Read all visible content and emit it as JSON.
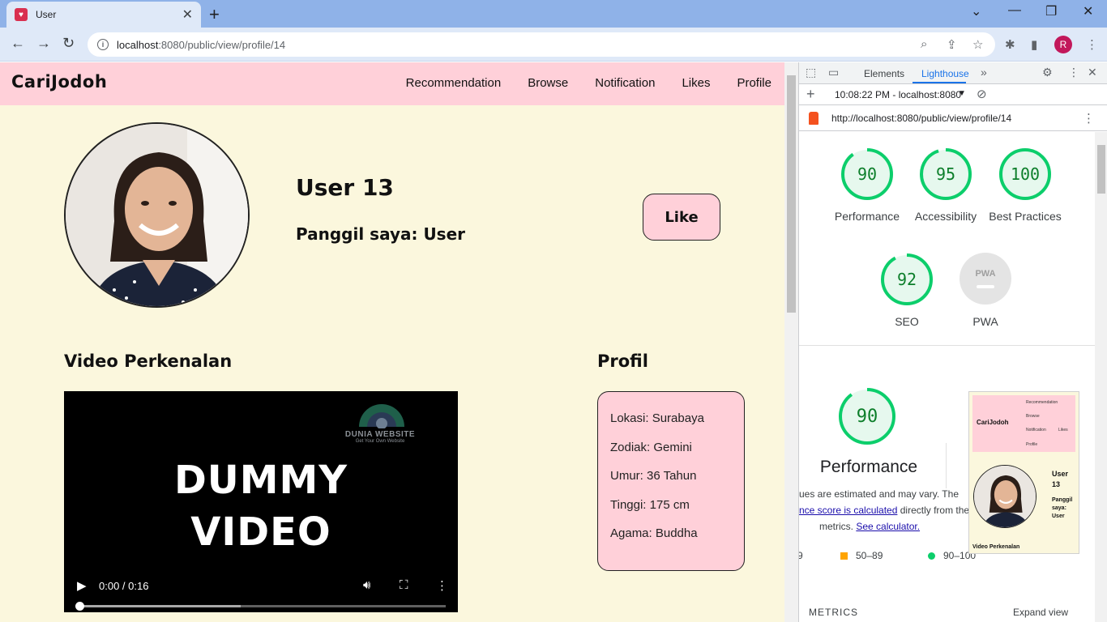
{
  "browser": {
    "tab_title": "User",
    "url_host": "localhost",
    "url_port_path": ":8080/public/view/profile/14",
    "profile_initial": "R"
  },
  "site": {
    "logo": "CariJodoh",
    "nav": [
      "Recommendation",
      "Browse",
      "Notification",
      "Likes",
      "Profile"
    ]
  },
  "profile": {
    "name": "User 13",
    "nickname": "Panggil saya: User",
    "like_label": "Like",
    "video_heading": "Video Perkenalan",
    "profil_heading": "Profil",
    "details": [
      "Lokasi: Surabaya",
      "Zodiak: Gemini",
      "Umur: 36 Tahun",
      "Tinggi: 175 cm",
      "Agama: Buddha"
    ]
  },
  "video": {
    "watermark": "DUNIA WEBSITE",
    "watermark_sub": "Get Your Own Website",
    "title_line1": "DUMMY",
    "title_line2": "VIDEO",
    "time": "0:00 / 0:16",
    "progress_buffered": 0.44
  },
  "devtools": {
    "tabs": [
      "Elements",
      "Lighthouse"
    ],
    "active_tab": "Lighthouse",
    "report_time": "10:08:22 PM - localhost:8080",
    "report_url": "http://localhost:8080/public/view/profile/14",
    "scores": [
      {
        "label": "Performance",
        "value": 90
      },
      {
        "label": "Accessibility",
        "value": 95
      },
      {
        "label": "Best Practices",
        "value": 100
      },
      {
        "label": "SEO",
        "value": 92
      }
    ],
    "pwa_label": "PWA",
    "pwa_badge": "PWA",
    "perf_score": 90,
    "perf_title": "Performance",
    "perf_note_1": "ues are estimated and may vary. The",
    "perf_note_link1": "nce score is calculated",
    "perf_note_2": "directly from thes",
    "perf_note_3": "metrics.",
    "perf_note_link2": "See calculator.",
    "legend_partial": "9",
    "legend_mid": "50–89",
    "legend_high": "90–100",
    "metrics_label": "METRICS",
    "expand_label": "Expand view",
    "thumb_logo": "CariJodoh",
    "thumb_menu": [
      "Recommendation",
      "Browse",
      "Notification",
      "Likes",
      "Profile"
    ],
    "thumb_user": "User 13",
    "thumb_nick": "Panggil saya: User",
    "thumb_video": "Video Perkenalan"
  },
  "colors": {
    "page_bg": "#fbf7dd",
    "nav_pink": "#ffd0d9",
    "score_green": "#0cce6b",
    "score_orange": "#ffa400"
  }
}
